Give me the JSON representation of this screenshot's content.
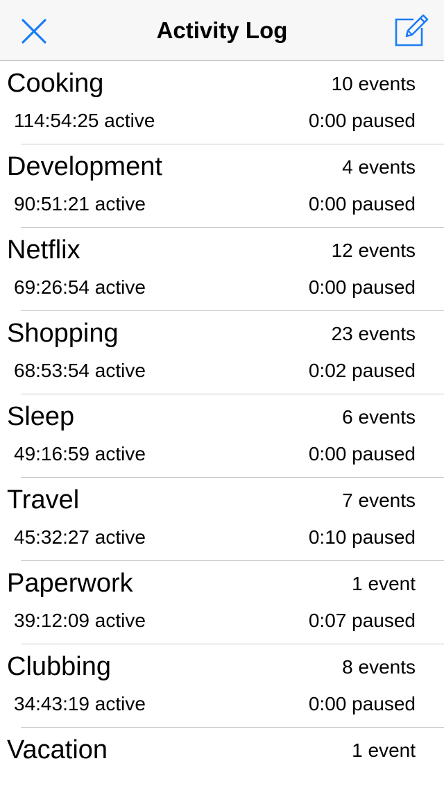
{
  "navbar": {
    "title": "Activity Log",
    "close_icon": "close-icon",
    "compose_icon": "compose-icon",
    "accent_color": "#1a7cf5"
  },
  "activities": [
    {
      "name": "Cooking",
      "events": "10 events",
      "active": "114:54:25 active",
      "paused": "0:00 paused"
    },
    {
      "name": "Development",
      "events": "4 events",
      "active": "90:51:21 active",
      "paused": "0:00 paused"
    },
    {
      "name": "Netflix",
      "events": "12 events",
      "active": "69:26:54 active",
      "paused": "0:00 paused"
    },
    {
      "name": "Shopping",
      "events": "23 events",
      "active": "68:53:54 active",
      "paused": "0:02 paused"
    },
    {
      "name": "Sleep",
      "events": "6 events",
      "active": "49:16:59 active",
      "paused": "0:00 paused"
    },
    {
      "name": "Travel",
      "events": "7 events",
      "active": "45:32:27 active",
      "paused": "0:10 paused"
    },
    {
      "name": "Paperwork",
      "events": "1 event",
      "active": "39:12:09 active",
      "paused": "0:07 paused"
    },
    {
      "name": "Clubbing",
      "events": "8 events",
      "active": "34:43:19 active",
      "paused": "0:00 paused"
    },
    {
      "name": "Vacation",
      "events": "1 event"
    }
  ]
}
